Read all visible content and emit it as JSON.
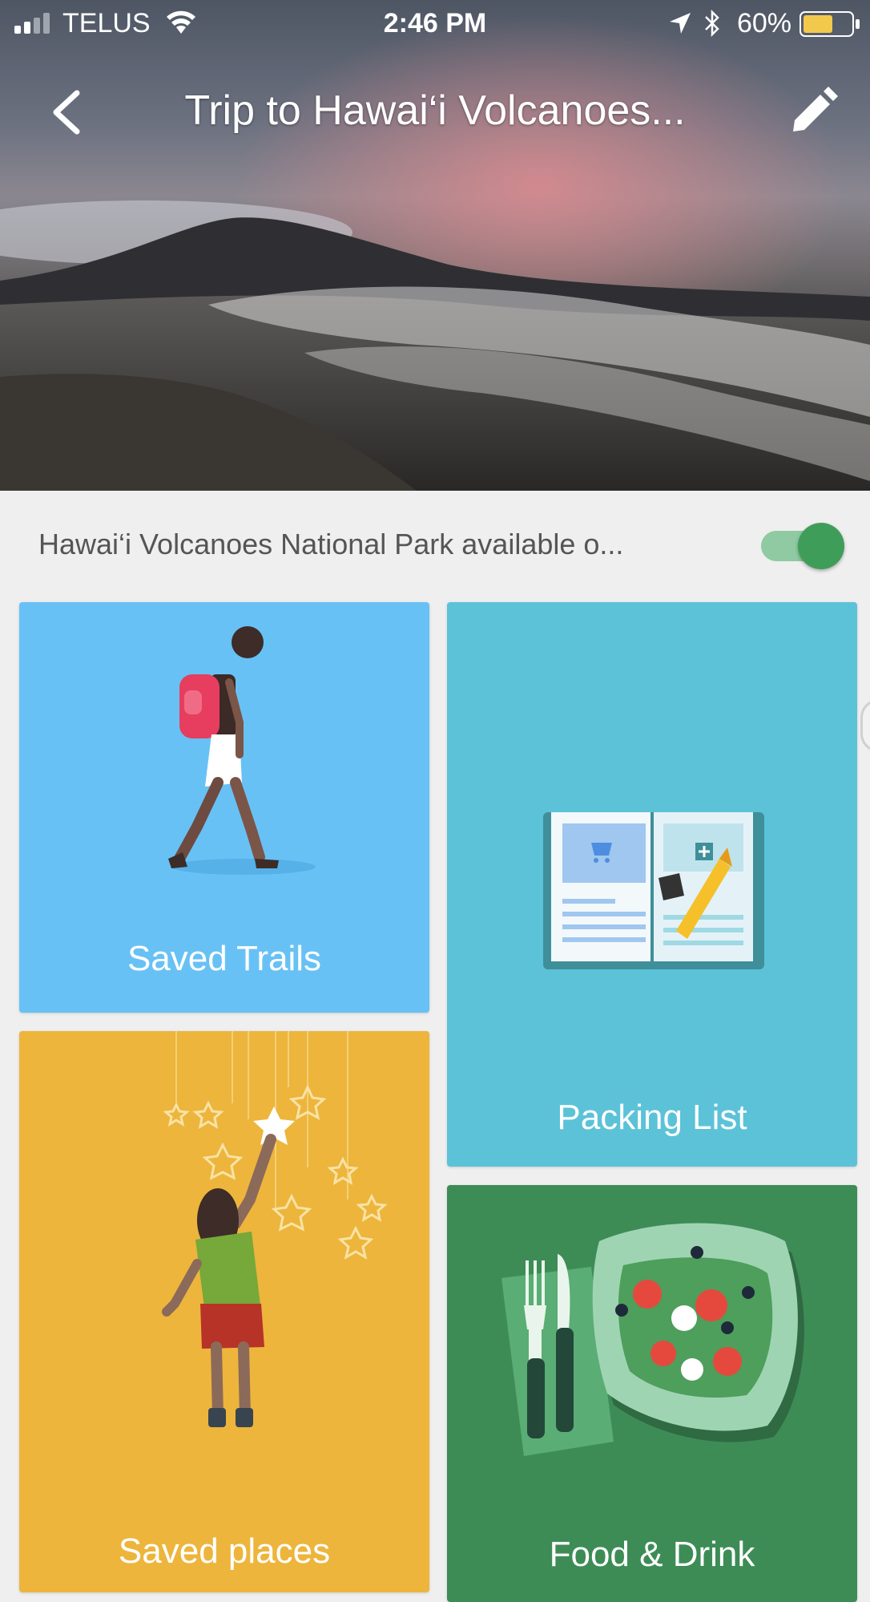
{
  "status_bar": {
    "carrier": "TELUS",
    "time": "2:46 PM",
    "battery_percent": "60%"
  },
  "nav": {
    "title": "Trip to Hawai‘i Volcanoes..."
  },
  "offline": {
    "label": "Hawai‘i Volcanoes National Park available o...",
    "toggle_on": true
  },
  "cards": {
    "saved_trails": "Saved Trails",
    "packing_list": "Packing List",
    "saved_places": "Saved places",
    "food_drink": "Food & Drink"
  },
  "colors": {
    "trails": "#68c1f5",
    "packing": "#5cc2d8",
    "places": "#edb53c",
    "food": "#3d8c56",
    "toggle": "#3f9d5a"
  },
  "icons": [
    "signal-icon",
    "wifi-icon",
    "location-arrow-icon",
    "bluetooth-icon",
    "battery-icon",
    "back-chevron-icon",
    "pencil-icon"
  ]
}
